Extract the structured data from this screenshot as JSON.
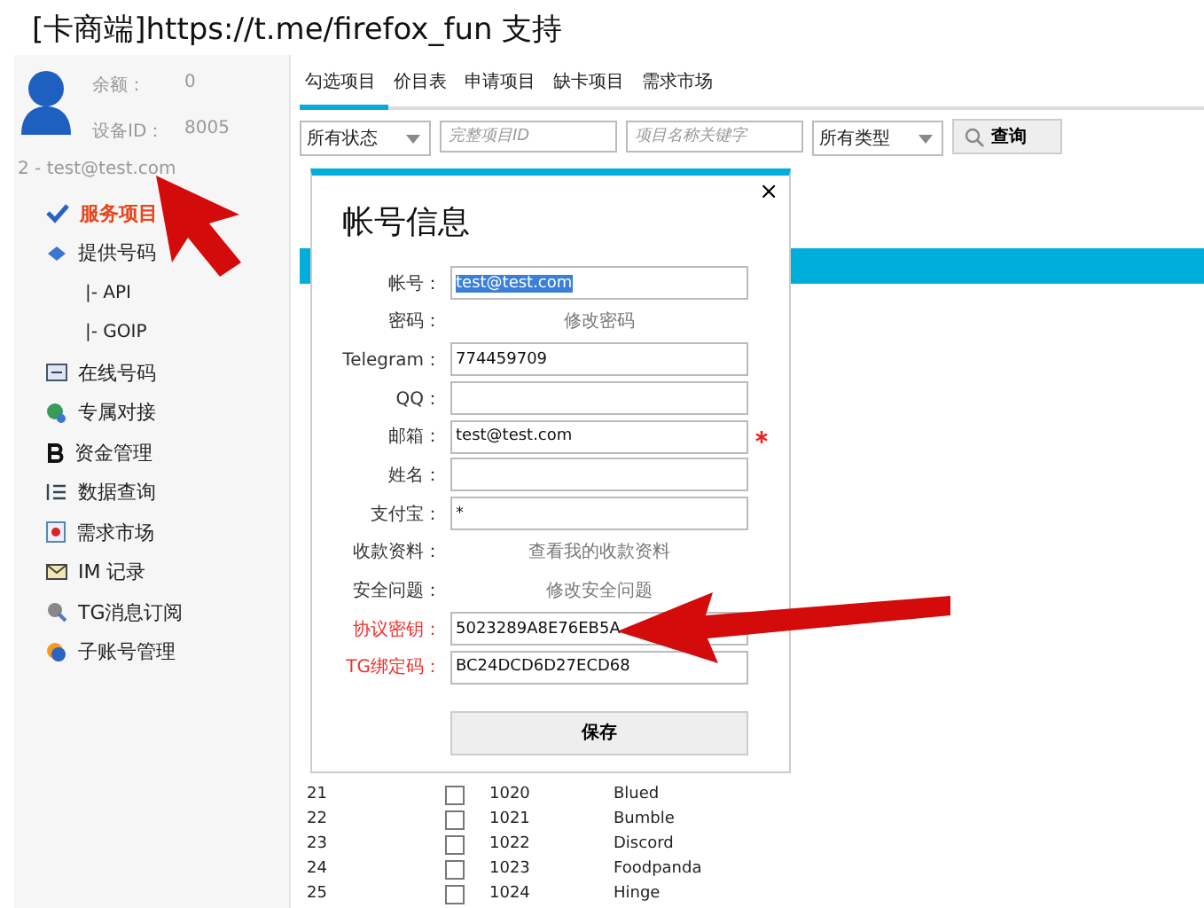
{
  "window": {
    "title": "[卡商端]https://t.me/firefox_fun 支持"
  },
  "account": {
    "balance_label": "余额：",
    "balance": "0",
    "device_label": "设备ID：",
    "device": "8005",
    "user": "2 - test@test.com"
  },
  "sidebar": {
    "items": [
      {
        "label": "服务项目",
        "selected": true
      },
      {
        "label": "提供号码",
        "selected": false,
        "children": [
          {
            "label": "|- API",
            "selected": false
          },
          {
            "label": "|- GOIP",
            "selected": false
          }
        ]
      },
      {
        "label": "在线号码",
        "selected": false
      },
      {
        "label": "专属对接",
        "selected": false
      },
      {
        "label": "资金管理",
        "selected": false
      },
      {
        "label": "数据查询",
        "selected": false
      },
      {
        "label": "需求市场",
        "selected": false
      },
      {
        "label": "IM 记录",
        "selected": false
      },
      {
        "label": "TG消息订阅",
        "selected": false
      },
      {
        "label": "子账号管理",
        "selected": false
      }
    ]
  },
  "tabs": [
    {
      "label": "勾选项目",
      "selected": true
    },
    {
      "label": "价目表",
      "selected": false
    },
    {
      "label": "申请项目",
      "selected": false
    },
    {
      "label": "缺卡项目",
      "selected": false
    },
    {
      "label": "需求市场",
      "selected": false
    }
  ],
  "filters": [
    {
      "kind": "select",
      "value": "所有状态"
    },
    {
      "kind": "input",
      "placeholder": "完整项目ID"
    },
    {
      "kind": "input",
      "placeholder": "项目名称关键字"
    },
    {
      "kind": "select",
      "value": "所有类型"
    }
  ],
  "query_button": "查询",
  "table": {
    "rows": [
      {
        "no": "21",
        "checked": false,
        "id": "1020",
        "name": "Blued"
      },
      {
        "no": "22",
        "checked": false,
        "id": "1021",
        "name": "Bumble"
      },
      {
        "no": "23",
        "checked": false,
        "id": "1022",
        "name": "Discord"
      },
      {
        "no": "24",
        "checked": false,
        "id": "1023",
        "name": "Foodpanda"
      },
      {
        "no": "25",
        "checked": false,
        "id": "1024",
        "name": "Hinge"
      }
    ]
  },
  "dialog": {
    "title": "帐号信息",
    "close": "×",
    "fields": [
      {
        "label": "帐号：",
        "kind": "input",
        "value": "test@test.com",
        "text_selected": true,
        "alert": false,
        "required": false
      },
      {
        "label": "密码：",
        "kind": "link",
        "value": "修改密码",
        "alert": false,
        "required": false
      },
      {
        "label": "Telegram：",
        "kind": "input",
        "value": "774459709",
        "text_selected": false,
        "alert": false,
        "required": false
      },
      {
        "label": "QQ：",
        "kind": "input",
        "alert": false,
        "required": false
      },
      {
        "label": "邮箱：",
        "kind": "input",
        "value": "test@test.com",
        "text_selected": false,
        "alert": false,
        "required": true
      },
      {
        "label": "姓名：",
        "kind": "input",
        "alert": false,
        "required": false
      },
      {
        "label": "支付宝：",
        "kind": "input",
        "value": "*",
        "text_selected": false,
        "alert": false,
        "required": false
      },
      {
        "label": "收款资料：",
        "kind": "link",
        "value": "查看我的收款资料",
        "alert": false,
        "required": false
      },
      {
        "label": "安全问题：",
        "kind": "link",
        "value": "修改安全问题",
        "alert": false,
        "required": false
      },
      {
        "label": "协议密钥：",
        "kind": "input",
        "value": "5023289A8E76EB5A",
        "text_selected": false,
        "alert": true,
        "required": false
      },
      {
        "label": "TG绑定码：",
        "kind": "input",
        "value": "BC24DCD6D27ECD68",
        "text_selected": false,
        "alert": true,
        "required": false
      }
    ],
    "save": "保存"
  }
}
